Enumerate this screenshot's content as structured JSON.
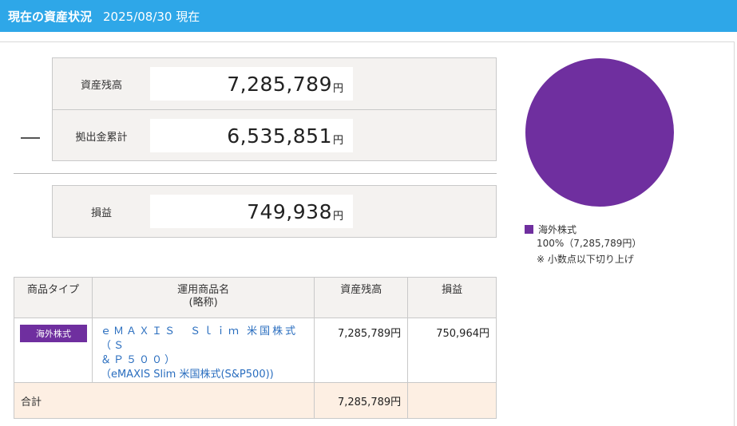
{
  "header": {
    "title": "現在の資産状況",
    "date": "2025/08/30 現在"
  },
  "summary": {
    "balance": {
      "label": "資産残高",
      "value": "7,285,789",
      "unit": "円"
    },
    "contribution": {
      "label": "拠出金累計",
      "value": "6,535,851",
      "unit": "円"
    },
    "operator": "—",
    "profit": {
      "label": "損益",
      "value": "749,938",
      "unit": "円"
    }
  },
  "chart_data": {
    "type": "pie",
    "categories": [
      "海外株式"
    ],
    "values": [
      100
    ],
    "colors": [
      "#6f2f9f"
    ],
    "legend": [
      {
        "name": "海外株式",
        "percent": "100%（7,285,789円）",
        "color": "#6f2f9f"
      }
    ],
    "note": "※ 小数点以下切り上げ"
  },
  "table": {
    "headers": {
      "type": "商品タイプ",
      "product_line1": "運用商品名",
      "product_line2": "(略称)",
      "balance": "資産残高",
      "profit": "損益"
    },
    "rows": [
      {
        "type": "海外株式",
        "type_color": "#6f2f9f",
        "name_line1": "ｅＭＡＸＩＳ　Ｓｌｉｍ 米国株式（Ｓ",
        "name_line2": "＆Ｐ５００）",
        "name_short": "（eMAXIS Slim 米国株式(S&P500))",
        "balance": "7,285,789円",
        "profit": "750,964円"
      }
    ],
    "total": {
      "label": "合計",
      "balance": "7,285,789円",
      "profit": ""
    }
  }
}
